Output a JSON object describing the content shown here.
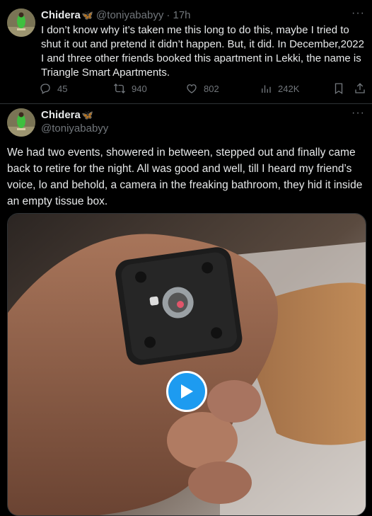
{
  "tweet1": {
    "name": "Chidera",
    "name_emoji": "🦋",
    "handle": "@toniyababyy",
    "time": "· 17h",
    "text": "I don’t know why it’s taken me this long to do this, maybe I tried to shut it out and pretend it didn’t happen. But, it did. In December,2022 I and three other friends booked this apartment in Lekki, the name is Triangle Smart Apartments.",
    "replies": "45",
    "retweets": "940",
    "likes": "802",
    "views": "242K"
  },
  "tweet2": {
    "name": "Chidera",
    "name_emoji": "🦋",
    "handle": "@toniyababyy",
    "text": "We had two events, showered in between, stepped out and finally came back to retire for the night. All was good and well, till I heard my friend’s voice, lo and behold, a camera in the freaking bathroom, they hid it inside an empty tissue box."
  },
  "colors": {
    "accent": "#1d9bf0",
    "background": "#000000",
    "text": "#e7e9ea",
    "muted": "#71767b",
    "divider": "#2f3336"
  },
  "icons": [
    "more-icon",
    "reply-icon",
    "retweet-icon",
    "like-icon",
    "views-icon",
    "bookmark-icon",
    "share-icon",
    "play-icon",
    "butterfly-icon"
  ]
}
